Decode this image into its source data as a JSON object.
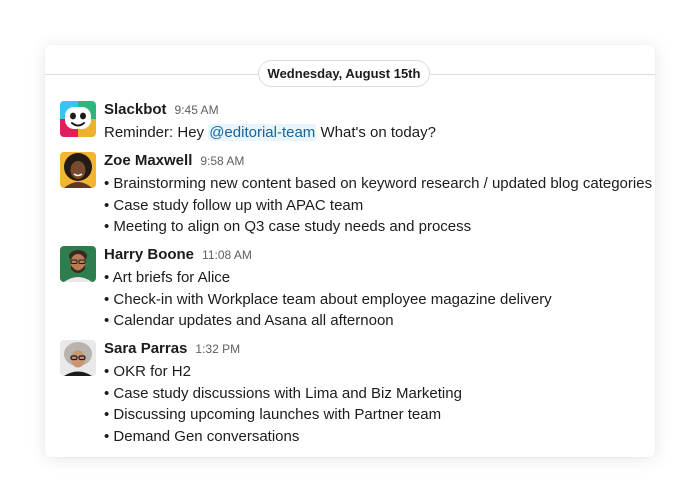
{
  "date_divider": "Wednesday, August 15th",
  "colors": {
    "mention_text": "#1264a3",
    "mention_bg": "#e8f5fa",
    "slack_green": "#2eb67d",
    "slack_blue": "#36c5f0",
    "slack_red": "#e01e5a",
    "slack_yellow": "#ecb22e"
  },
  "messages": [
    {
      "author": "Slackbot",
      "avatar_icon": "slackbot-icon",
      "time": "9:45 AM",
      "text_prefix": "Reminder: Hey ",
      "mention": "@editorial-team",
      "text_suffix": " What's on today?"
    },
    {
      "author": "Zoe Maxwell",
      "avatar_icon": "zoe-maxwell-avatar",
      "time": "9:58 AM",
      "lines": [
        "• Brainstorming new content based on keyword research / updated blog categories",
        "• Case study follow up with APAC team",
        "• Meeting to align on Q3 case study needs and process"
      ]
    },
    {
      "author": "Harry Boone",
      "avatar_icon": "harry-boone-avatar",
      "time": "11:08 AM",
      "lines": [
        "• Art briefs for Alice",
        "• Check-in with Workplace team about employee magazine delivery",
        "• Calendar updates and Asana all afternoon"
      ]
    },
    {
      "author": "Sara Parras",
      "avatar_icon": "sara-parras-avatar",
      "time": "1:32 PM",
      "lines": [
        "• OKR for H2",
        "• Case study discussions with Lima and Biz Marketing",
        "• Discussing upcoming launches with Partner team",
        "• Demand Gen conversations"
      ]
    }
  ]
}
